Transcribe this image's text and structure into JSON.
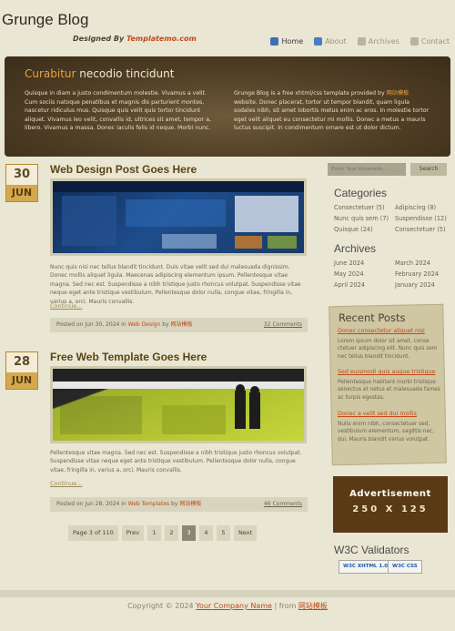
{
  "header": {
    "site_title": "Grunge Blog",
    "tagline_prefix": "Designed By ",
    "tagline_brand": "Templatemo.com",
    "nav": [
      {
        "label": "Home",
        "icon": "home-icon",
        "color": "#3d6fb0"
      },
      {
        "label": "About",
        "icon": "user-icon",
        "color": "#4b7bc2"
      },
      {
        "label": "Archives",
        "icon": "archive-icon",
        "color": "#9a9478"
      },
      {
        "label": "Contact",
        "icon": "contact-icon",
        "color": "#9a9478"
      }
    ]
  },
  "banner": {
    "title_accent": "Curabitur",
    "title_rest": " necodio tincidunt",
    "left_text": "Quisque in diam a justo condimentum molestie. Vivamus a velit. Cum sociis natoque penatibus et magnis dis parturient montes, nascetur ridiculus mus. Quisque quis velit quis tortor tincidunt aliquet. Vivamus leo velit, convallis id, ultrices sit amet, tempor a, libero. Vivamus a massa. Donec iaculis felis id neque. Morbi nunc.",
    "right_text_before": "Grunge Blog is a free xhtml/css template provided by ",
    "right_link": "网站模板",
    "right_text_after": " website. Donec placerat, tortor ut tempor blandit, quam ligula sodales nibh, sit amet lobortis metus enim ac eros. In molestie tortor eget velit aliquet eu consectetur mi mollis. Donec a metus a mauris luctus suscipit. In condimentum ornare est ut dolor dictum."
  },
  "posts": [
    {
      "day": "30",
      "month": "JUN",
      "title": "Web Design Post Goes Here",
      "body": "Nunc quis nisi nec tellus blandit tincidunt. Duis vitae velit sed dui malesuada dignissim. Donec mollis aliquet ligula. Maecenas adipiscing elementum ipsum. Pellentesque vitae magna. Sed nec est. Suspendisse a nibh tristique justo rhoncus volutpat. Suspendisse vitae neque eget ante tristique vestibulum. Pellentesque dolor nulla, congue vitae, fringilla in, varius a, orci. Mauris convallis.",
      "more": "Continue...",
      "meta_prefix": "Posted on Jun 30, 2024 in ",
      "category": "Web Design",
      "meta_by": " by ",
      "author": "网站模板",
      "comments": "32 Comments"
    },
    {
      "day": "28",
      "month": "JUN",
      "title": "Free Web Template Goes Here",
      "body": "Pellentesque vitae magna. Sed nec est. Suspendisse a nibh tristique justo rhoncus volutpat. Suspendisse vitae neque eget ante tristique vestibulum. Pellentesque dolor nulla, congue vitae, fringilla in, varius a, orci. Mauris convallis.",
      "more": "Continue...",
      "meta_prefix": "Posted on Jun 28, 2024 in ",
      "category": "Web Templates",
      "meta_by": " by ",
      "author": "网站模板",
      "comments": "46 Comments"
    }
  ],
  "pagination": [
    "Page 3 of 110",
    "Prev",
    "1",
    "2",
    "3",
    "4",
    "5",
    "Next"
  ],
  "pagination_current": "3",
  "sidebar": {
    "search_placeholder": "Enter Your Keywords...",
    "search_button": "Search",
    "categories_title": "Categories",
    "categories_left": [
      "Consectetuer (5)",
      "Nunc quis sem (7)",
      "Quisque (24)"
    ],
    "categories_right": [
      "Adipiscing (8)",
      "Suspendisse (12)",
      "Consectetuer (5)"
    ],
    "archives_title": "Archives",
    "archives_left": [
      "June 2024",
      "May 2024",
      "April 2024"
    ],
    "archives_right": [
      "March 2024",
      "February 2024",
      "January 2024"
    ],
    "recent_title": "Recent Posts",
    "recent_items": [
      {
        "title": "Donec consectetur aliquet nisi",
        "text": "Lorem ipsum dolor sit amet, conse ctetuer adipiscing elit. Nunc quis sem nec tellus blandit tincidunt."
      },
      {
        "title": "Sed euismodi quis augue tristique",
        "text": "Pellentesque habitant morbi tristique senectus et netus et malesuada fames ac turpis egestas."
      },
      {
        "title": "Donec a velit sed dui mollis",
        "text": "Nulla enim nibh, consectetuer sed, vestibulum elementum, sagittis nec, dui. Mauris blandit varius volutpat."
      }
    ],
    "ad_title": "Advertisement",
    "ad_size": "250 X 125",
    "validators_title": "W3C Validators",
    "badges": [
      "W3C XHTML 1.0",
      "W3C CSS"
    ]
  },
  "footer": {
    "prefix": "Copyright © 2024 ",
    "company": "Your Company Name",
    "mid": " | from ",
    "link": "网站模板"
  }
}
